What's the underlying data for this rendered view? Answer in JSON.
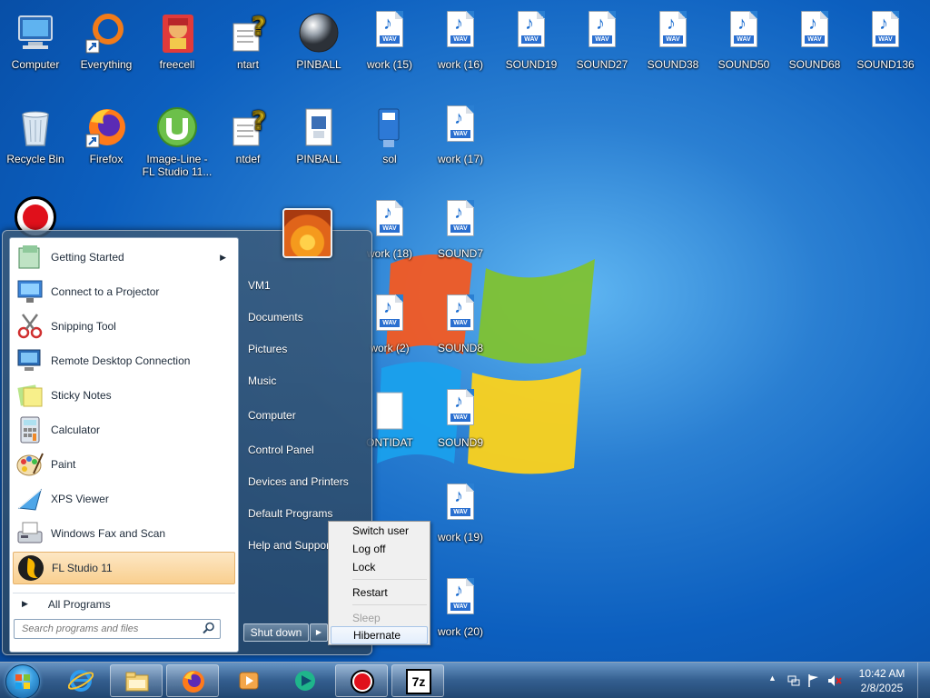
{
  "desktop": {
    "icons": [
      {
        "label": "Computer",
        "icon": "computer-icon"
      },
      {
        "label": "Everything",
        "icon": "everything-icon"
      },
      {
        "label": "freecell",
        "icon": "freecell-icon"
      },
      {
        "label": "ntart",
        "icon": "help-file-icon"
      },
      {
        "label": "PINBALL",
        "icon": "pinball-icon"
      },
      {
        "label": "work (15)",
        "icon": "wav-file-icon"
      },
      {
        "label": "work (16)",
        "icon": "wav-file-icon"
      },
      {
        "label": "SOUND19",
        "icon": "wav-file-icon"
      },
      {
        "label": "SOUND27",
        "icon": "wav-file-icon"
      },
      {
        "label": "SOUND38",
        "icon": "wav-file-icon"
      },
      {
        "label": "SOUND50",
        "icon": "wav-file-icon"
      },
      {
        "label": "SOUND68",
        "icon": "wav-file-icon"
      },
      {
        "label": "SOUND136",
        "icon": "wav-file-icon"
      },
      {
        "label": "Recycle Bin",
        "icon": "recycle-bin-icon"
      },
      {
        "label": "Firefox",
        "icon": "firefox-icon"
      },
      {
        "label": "Image-Line - FL Studio 11...",
        "icon": "utorrent-icon"
      },
      {
        "label": "ntdef",
        "icon": "help-file-icon"
      },
      {
        "label": "PINBALL",
        "icon": "pinball-doc-icon"
      },
      {
        "label": "sol",
        "icon": "solitaire-icon"
      },
      {
        "label": "work (17)",
        "icon": "wav-file-icon"
      },
      {
        "label": "work (18)",
        "icon": "wav-file-icon"
      },
      {
        "label": "SOUND7",
        "icon": "wav-file-icon"
      },
      {
        "label": "work (2)",
        "icon": "wav-file-icon"
      },
      {
        "label": "SOUND8",
        "icon": "wav-file-icon"
      },
      {
        "label": "ONTIDAT",
        "icon": "file-icon"
      },
      {
        "label": "SOUND9",
        "icon": "wav-file-icon"
      },
      {
        "label": "work (19)",
        "icon": "wav-file-icon"
      },
      {
        "label": "work (20)",
        "icon": "wav-file-icon"
      }
    ],
    "wav_tag": "WAV"
  },
  "start_menu": {
    "programs": [
      {
        "label": "Getting Started",
        "icon": "getting-started-icon",
        "has_submenu": true
      },
      {
        "label": "Connect to a Projector",
        "icon": "projector-icon"
      },
      {
        "label": "Snipping Tool",
        "icon": "scissors-icon"
      },
      {
        "label": "Remote Desktop Connection",
        "icon": "remote-desktop-icon"
      },
      {
        "label": "Sticky Notes",
        "icon": "sticky-notes-icon"
      },
      {
        "label": "Calculator",
        "icon": "calculator-icon"
      },
      {
        "label": "Paint",
        "icon": "paint-palette-icon"
      },
      {
        "label": "XPS Viewer",
        "icon": "xps-viewer-icon"
      },
      {
        "label": "Windows Fax and Scan",
        "icon": "fax-icon"
      },
      {
        "label": "FL Studio 11",
        "icon": "fl-studio-icon",
        "highlighted": true
      }
    ],
    "all_programs": "All Programs",
    "search_placeholder": "Search programs and files",
    "right_links": [
      "VM1",
      "Documents",
      "Pictures",
      "Music",
      "Computer",
      "Control Panel",
      "Devices and Printers",
      "Default Programs",
      "Help and Support"
    ],
    "shutdown_label": "Shut down"
  },
  "shutdown_menu": {
    "items": [
      {
        "label": "Switch user",
        "enabled": true
      },
      {
        "label": "Log off",
        "enabled": true
      },
      {
        "label": "Lock",
        "enabled": true
      },
      {
        "label": "Restart",
        "enabled": true
      },
      {
        "label": "Sleep",
        "enabled": false
      },
      {
        "label": "Hibernate",
        "enabled": true,
        "hovered": true
      }
    ]
  },
  "taskbar": {
    "pinned": [
      "internet-explorer-icon",
      "file-explorer-icon",
      "firefox-icon",
      "media-player-icon",
      "app-icon",
      "record-icon",
      "7zip-icon"
    ],
    "seven_zip_label": "7z",
    "clock_time": "10:42 AM",
    "clock_date": "2/8/2025"
  },
  "colors": {
    "wallpaper": "#0c5fbf",
    "highlight": "#f9cf8f",
    "submenu_bg": "#f0f0f0"
  }
}
